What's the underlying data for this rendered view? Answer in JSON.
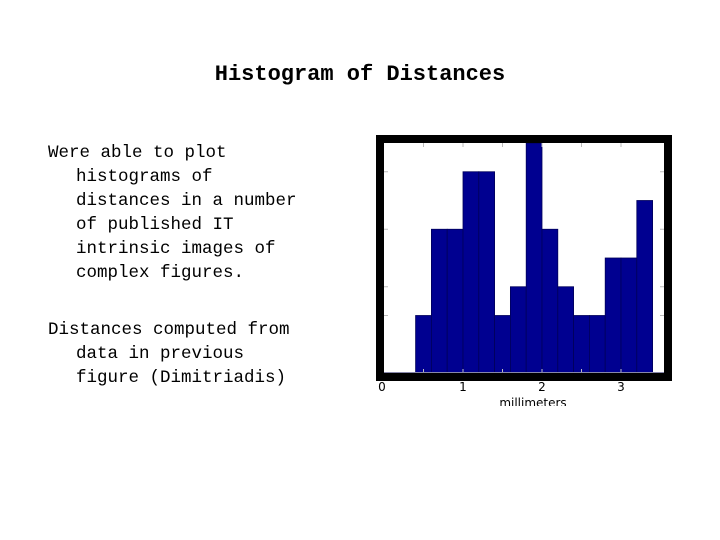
{
  "slide": {
    "title": "Histogram of Distances",
    "paragraphs": [
      {
        "lines": [
          "Were able to plot",
          "histograms of",
          "distances in a number",
          "of published IT",
          "intrinsic images of",
          "complex figures."
        ]
      },
      {
        "lines": [
          "Distances computed from",
          "data in previous",
          "figure (Dimitriadis)"
        ]
      }
    ]
  },
  "colors": {
    "bar_fill": "#000090",
    "bar_edge": "#00005a",
    "frame": "#000000",
    "background": "#ffffff"
  },
  "chart_data": {
    "type": "bar",
    "title": "",
    "xlabel": "millimeters",
    "ylabel": "",
    "xlim": [
      0,
      3.5
    ],
    "ylim": [
      0,
      8
    ],
    "bin_width": 0.2,
    "bin_edges": [
      0.4,
      0.6,
      0.8,
      1.0,
      1.2,
      1.4,
      1.6,
      1.8,
      2.0,
      2.2,
      2.4,
      2.6,
      2.8,
      3.0,
      3.2,
      3.4
    ],
    "values": [
      2,
      5,
      5,
      7,
      7,
      2,
      3,
      8,
      5,
      3,
      2,
      2,
      4,
      4,
      6
    ],
    "x_ticks": [
      0,
      1,
      2,
      3
    ],
    "x_tick_labels": [
      "0",
      "1",
      "2",
      "3"
    ],
    "x_minor_ticks": [
      0.5,
      1.0,
      1.5,
      2.0,
      2.5,
      3.0
    ],
    "y_ticks": [
      2,
      3,
      5,
      7
    ],
    "y_tick_labels": [],
    "grid": false,
    "legend": "none"
  }
}
